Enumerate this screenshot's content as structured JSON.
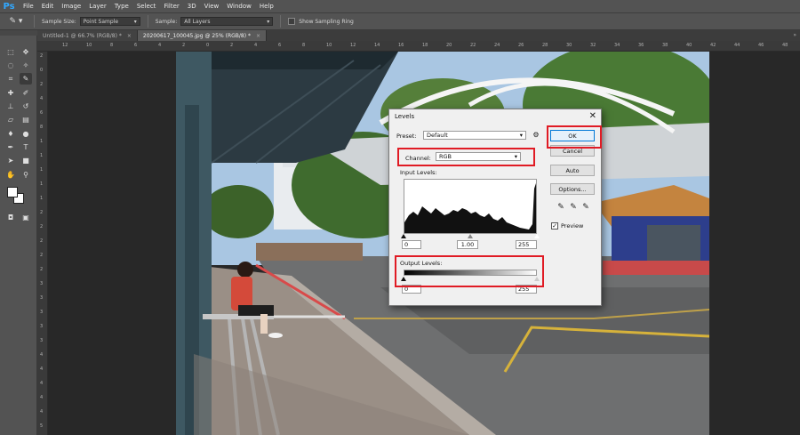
{
  "app": {
    "logo": "Ps",
    "accent": "#31a8ff"
  },
  "menu": [
    "File",
    "Edit",
    "Image",
    "Layer",
    "Type",
    "Select",
    "Filter",
    "3D",
    "View",
    "Window",
    "Help"
  ],
  "options": {
    "tool_icon": "eyedropper-icon",
    "sample_size_label": "Sample Size:",
    "sample_size_value": "Point Sample",
    "sample_label": "Sample:",
    "sample_value": "All Layers",
    "sampling_ring_label": "Show Sampling Ring"
  },
  "tabs": [
    {
      "label": "Untitled-1 @ 66.7% (RGB/8) *",
      "close": "×",
      "active": false
    },
    {
      "label": "20200617_100045.jpg @ 25% (RGB/8) *",
      "close": "×",
      "active": true
    }
  ],
  "ruler": {
    "top": [
      "12",
      "10",
      "8",
      "6",
      "4",
      "2",
      "0",
      "2",
      "4",
      "6",
      "8",
      "10",
      "12",
      "14",
      "16",
      "18",
      "20",
      "22",
      "24",
      "26",
      "28",
      "30",
      "32",
      "34",
      "36",
      "38",
      "40",
      "42",
      "44",
      "46",
      "48",
      "50"
    ],
    "left": [
      "2",
      "0",
      "2",
      "4",
      "6",
      "8",
      "1",
      "1",
      "1",
      "1",
      "1",
      "2",
      "2",
      "2",
      "2",
      "2",
      "3",
      "3",
      "3",
      "3",
      "3",
      "4",
      "4",
      "4",
      "4",
      "4",
      "5"
    ]
  },
  "dialog": {
    "title": "Levels",
    "close": "✕",
    "preset_label": "Preset:",
    "preset_value": "Default",
    "channel_label": "Channel:",
    "channel_value": "RGB",
    "input_levels_label": "Input Levels:",
    "input_values": [
      "0",
      "1.00",
      "255"
    ],
    "output_levels_label": "Output Levels:",
    "output_values": [
      "0",
      "255"
    ],
    "buttons": {
      "ok": "OK",
      "cancel": "Cancel",
      "auto": "Auto",
      "options": "Options..."
    },
    "preview_label": "Preview",
    "preview_checked": "✓",
    "highlight_color": "#e01b24"
  }
}
